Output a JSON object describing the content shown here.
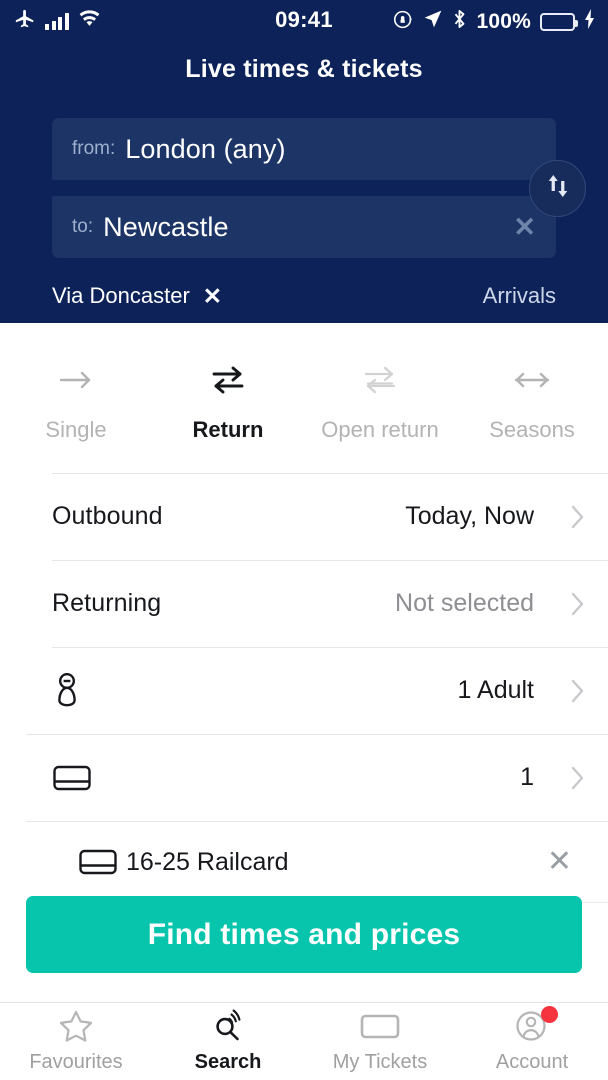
{
  "status_bar": {
    "airplane_icon": "airplane-icon",
    "signal_icon": "signal-bars-icon",
    "wifi_icon": "wifi-icon",
    "time": "09:41",
    "rotation_lock_icon": "rotation-lock-icon",
    "location_icon": "location-arrow-icon",
    "bluetooth_icon": "bluetooth-icon",
    "battery_percent": "100%",
    "battery_icon": "battery-icon",
    "charging_icon": "charging-bolt-icon",
    "battery_color": "#45e06a"
  },
  "header": {
    "title": "Live times & tickets",
    "background_color": "#0d2259",
    "from": {
      "label": "from:",
      "value": "London (any)"
    },
    "to": {
      "label": "to:",
      "value": "Newcastle",
      "clear_icon": "close-icon"
    },
    "swap_icon": "swap-vertical-icon",
    "via": {
      "label": "Via Doncaster",
      "clear_icon": "close-icon"
    },
    "arrivals_label": "Arrivals"
  },
  "ticket_type_tabs": [
    {
      "label": "Single",
      "icon": "arrow-right-icon",
      "active": false
    },
    {
      "label": "Return",
      "icon": "return-arrows-icon",
      "active": true
    },
    {
      "label": "Open return",
      "icon": "open-return-arrows-icon",
      "active": false
    },
    {
      "label": "Seasons",
      "icon": "arrow-left-right-icon",
      "active": false
    }
  ],
  "options": [
    {
      "label": "Outbound",
      "value": "Today, Now",
      "muted": false,
      "chevron_icon": "chevron-right-icon"
    },
    {
      "label": "Returning",
      "value": "Not selected",
      "muted": true,
      "chevron_icon": "chevron-right-icon"
    },
    {
      "icon": "passenger-icon",
      "value": "1 Adult",
      "muted": false,
      "chevron_icon": "chevron-right-icon"
    },
    {
      "icon": "railcard-icon",
      "value": "1",
      "muted": false,
      "chevron_icon": "chevron-right-icon"
    }
  ],
  "railcard": {
    "icon": "railcard-icon",
    "label": "16-25 Railcard",
    "remove_icon": "close-icon"
  },
  "cta": {
    "label": "Find times and prices",
    "color": "#07c5ac"
  },
  "bottom_nav": [
    {
      "label": "Favourites",
      "icon": "star-icon",
      "active": false,
      "badge": false
    },
    {
      "label": "Search",
      "icon": "search-live-icon",
      "active": true,
      "badge": false
    },
    {
      "label": "My Tickets",
      "icon": "ticket-card-icon",
      "active": false,
      "badge": false
    },
    {
      "label": "Account",
      "icon": "account-circle-icon",
      "active": false,
      "badge": true,
      "badge_color": "#f63440"
    }
  ]
}
